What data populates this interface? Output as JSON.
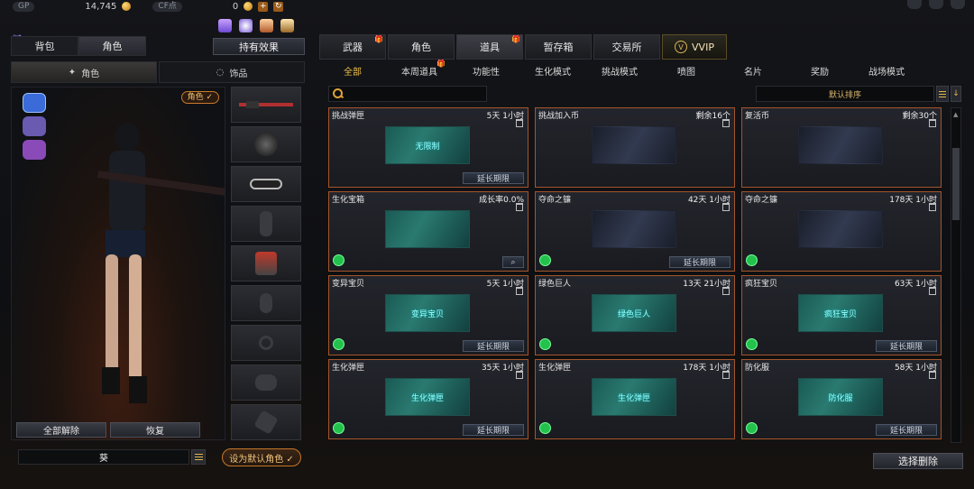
{
  "top": {
    "gp_label": "GP",
    "gp_value": "14,745",
    "cf_label": "CF点",
    "cf_value": "0",
    "plus_icon": "+",
    "coin_icon": "coin-icon"
  },
  "left": {
    "main_tabs": [
      "背包",
      "角色"
    ],
    "active_main_tab": "角色",
    "holding_effects_label": "持有效果",
    "sub_tabs": [
      "角色",
      "饰品"
    ],
    "role_badge": "角色 ✓",
    "unequip_all_label": "全部解除",
    "restore_label": "恢复",
    "character_name": "葵",
    "set_default_label": "设为默认角色 ✓"
  },
  "right": {
    "categories": [
      {
        "label": "武器",
        "gift": true
      },
      {
        "label": "角色",
        "gift": false
      },
      {
        "label": "道具",
        "gift": true
      },
      {
        "label": "暂存箱",
        "gift": false
      },
      {
        "label": "交易所",
        "gift": false
      },
      {
        "label": "VVIP",
        "gift": false
      }
    ],
    "active_category": "道具",
    "filters": [
      "全部",
      "本周道具",
      "功能性",
      "生化模式",
      "挑战模式",
      "喷图",
      "名片",
      "奖励",
      "战场模式"
    ],
    "active_filter": "全部",
    "search_placeholder": "",
    "sort_label": "默认排序",
    "cards": [
      {
        "name": "挑战弹匣",
        "time": "5天 1小时",
        "img_text": "无限制",
        "has_extend": true,
        "has_green": false,
        "has_mag": false
      },
      {
        "name": "挑战加入币",
        "time": "剩余16个",
        "img_text": "",
        "has_extend": false,
        "has_green": false,
        "has_mag": false
      },
      {
        "name": "复活币",
        "time": "剩余30个",
        "img_text": "",
        "has_extend": false,
        "has_green": false,
        "has_mag": false
      },
      {
        "name": "生化宝箱",
        "time": "成长率0.0%",
        "img_text": "",
        "has_extend": false,
        "has_green": true,
        "has_mag": true
      },
      {
        "name": "夺命之镰",
        "time": "42天 1小时",
        "img_text": "",
        "has_extend": true,
        "has_green": true,
        "has_mag": false
      },
      {
        "name": "夺命之镰",
        "time": "178天 1小时",
        "img_text": "",
        "has_extend": false,
        "has_green": true,
        "has_mag": false
      },
      {
        "name": "变异宝贝",
        "time": "5天 1小时",
        "img_text": "变异宝贝",
        "has_extend": true,
        "has_green": true,
        "has_mag": false
      },
      {
        "name": "绿色巨人",
        "time": "13天 21小时",
        "img_text": "绿色巨人",
        "has_extend": false,
        "has_green": true,
        "has_mag": false
      },
      {
        "name": "疯狂宝贝",
        "time": "63天 1小时",
        "img_text": "疯狂宝贝",
        "has_extend": true,
        "has_green": true,
        "has_mag": false
      },
      {
        "name": "生化弹匣",
        "time": "35天 1小时",
        "img_text": "生化弹匣",
        "has_extend": true,
        "has_green": true,
        "has_mag": false
      },
      {
        "name": "生化弹匣",
        "time": "178天 1小时",
        "img_text": "生化弹匣",
        "has_extend": false,
        "has_green": true,
        "has_mag": false
      },
      {
        "name": "防化服",
        "time": "58天 1小时",
        "img_text": "防化服",
        "has_extend": true,
        "has_green": true,
        "has_mag": false
      }
    ],
    "extend_label": "延长期限",
    "batch_delete_label": "选择删除"
  }
}
